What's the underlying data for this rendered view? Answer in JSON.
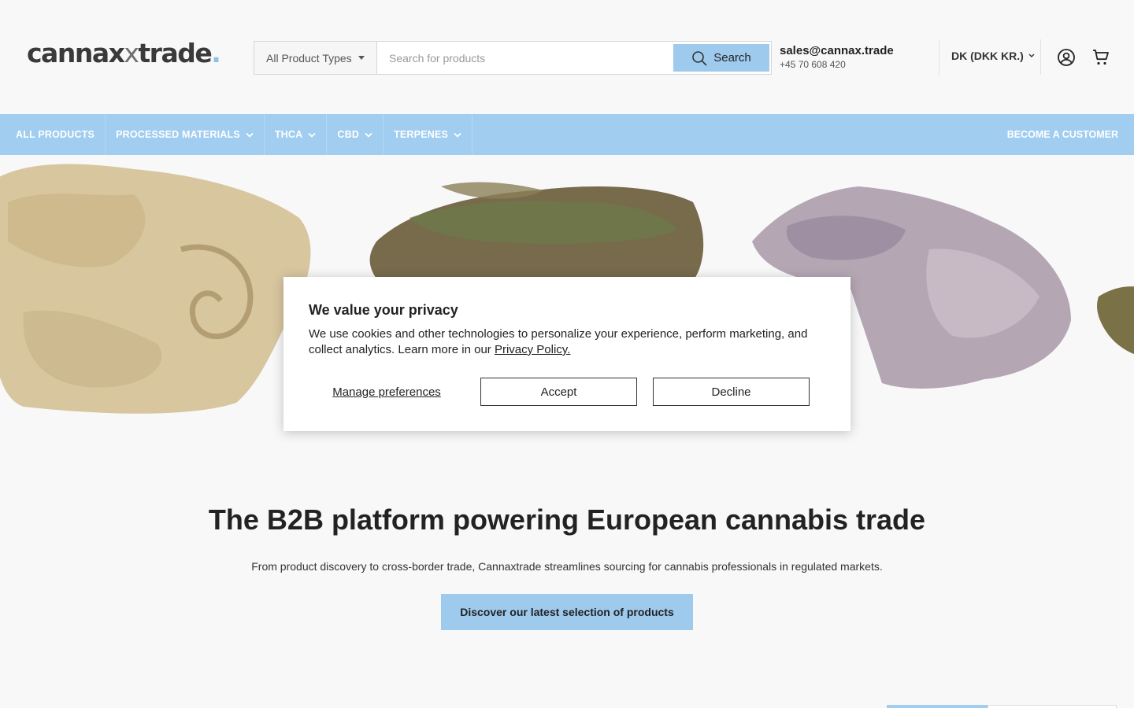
{
  "brand": {
    "logo_main": "cannax",
    "logo_x": "x",
    "logo_trade": "trade",
    "logo_dot": "."
  },
  "search": {
    "type_label": "All Product Types",
    "placeholder": "Search for products",
    "button_label": "Search"
  },
  "contact": {
    "email": "sales@cannax.trade",
    "phone": "+45 70 608 420"
  },
  "currency": "DK (DKK KR.)",
  "nav": {
    "items": [
      "ALL PRODUCTS",
      "PROCESSED MATERIALS",
      "THCA",
      "CBD",
      "TERPENES"
    ],
    "right": "BECOME A CUSTOMER"
  },
  "hero": {
    "headline": "The B2B platform powering European cannabis trade",
    "subline": "From product discovery to cross-border trade, Cannaxtrade streamlines sourcing for cannabis professionals in regulated markets.",
    "cta": "Discover our latest selection of products"
  },
  "cookie": {
    "title": "We value your privacy",
    "text": "We use cookies and other technologies to personalize your experience, perform marketing, and collect analytics. Learn more in our",
    "link": "Privacy Policy.",
    "manage": "Manage preferences",
    "accept": "Accept",
    "decline": "Decline"
  },
  "colors": {
    "accent": "#a0cdf0",
    "text": "#222222",
    "background": "#f8f8f8"
  },
  "icons": [
    "chevron-down-icon",
    "search-icon",
    "account-icon",
    "cart-icon"
  ]
}
